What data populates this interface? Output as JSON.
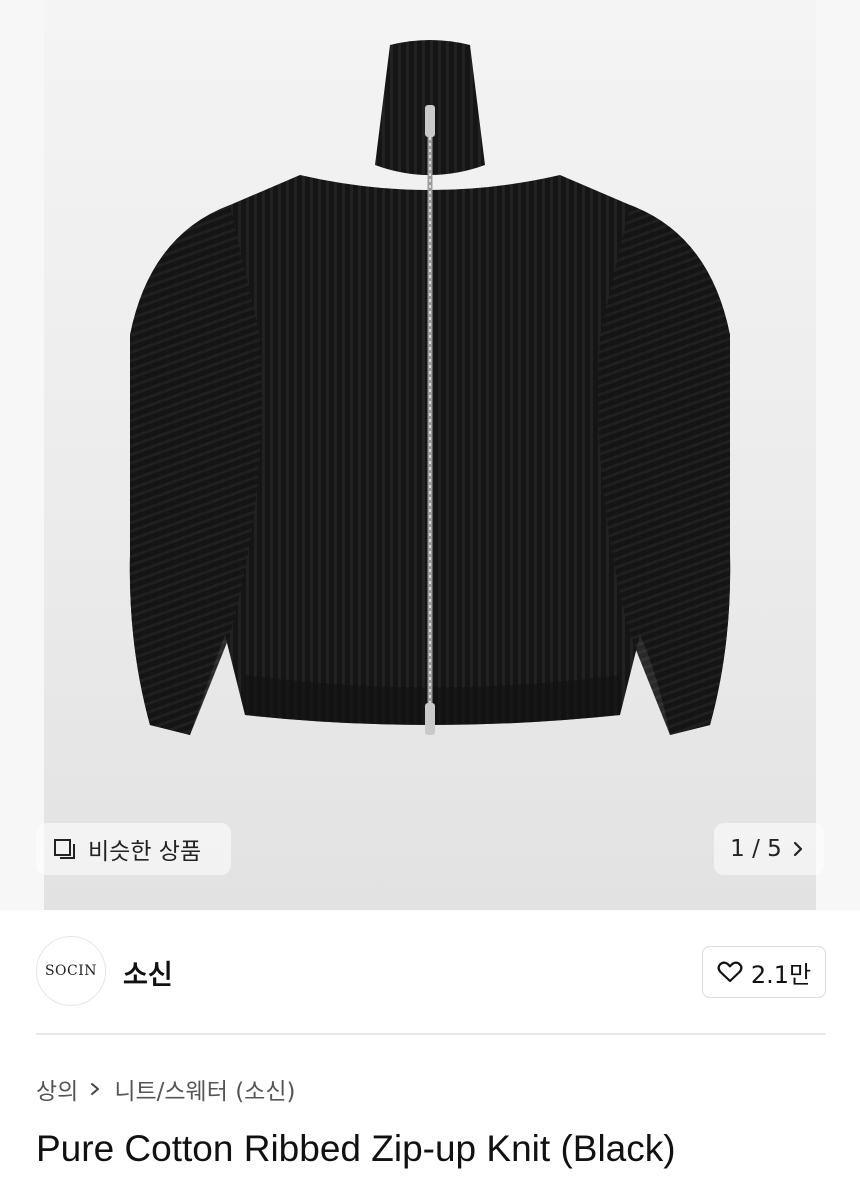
{
  "gallery": {
    "similar_label": "비슷한 상품",
    "pager_label": "1 / 5"
  },
  "brand": {
    "logo_text": "SOCIN",
    "name": "소신",
    "likes": "2.1만"
  },
  "breadcrumb": {
    "items": [
      "상의",
      "니트/스웨터 (소신)"
    ]
  },
  "product": {
    "title": "Pure Cotton Ribbed Zip-up Knit (Black)",
    "image": "black ribbed zip-up knit cardigan"
  }
}
